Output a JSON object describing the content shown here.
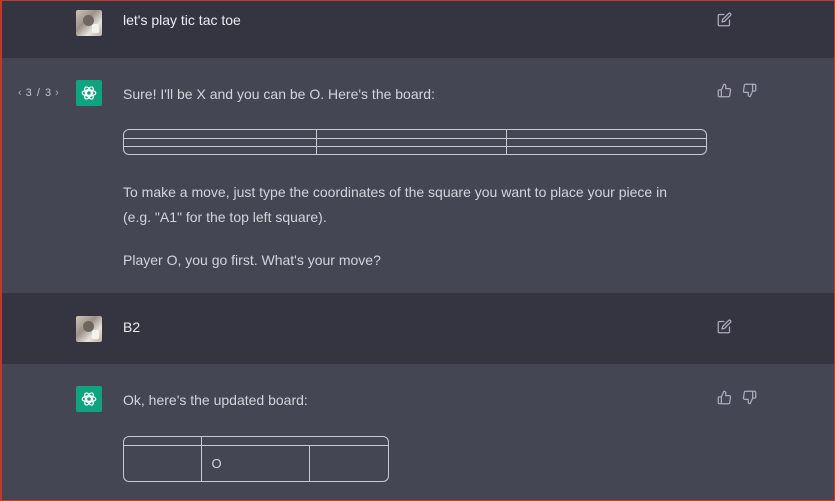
{
  "conversation": {
    "messages": [
      {
        "role": "user",
        "text": "let's play tic tac toe"
      },
      {
        "role": "assistant",
        "pager": {
          "prev": "‹",
          "label": "3 / 3",
          "next": "›"
        },
        "intro": "Sure! I'll be X and you can be O. Here's the board:",
        "board_rows": [
          [
            "",
            "",
            ""
          ],
          [
            "",
            "",
            ""
          ],
          [
            "",
            "",
            ""
          ]
        ],
        "para1_line1": "To make a move, just type the coordinates of the square you want to place your piece in",
        "para1_line2": "(e.g. \"A1\" for the top left square).",
        "para2": "Player O, you go first. What's your move?"
      },
      {
        "role": "user",
        "text": "B2"
      },
      {
        "role": "assistant",
        "intro": "Ok, here's the updated board:",
        "board_rows": [
          [
            "",
            ""
          ],
          [
            "",
            "O",
            ""
          ]
        ]
      }
    ]
  },
  "icons": {
    "edit": "edit-icon",
    "thumbs_up": "thumbs-up-icon",
    "thumbs_down": "thumbs-down-icon",
    "bot_logo": "openai-logo-icon"
  },
  "colors": {
    "user_row_bg": "#343541",
    "assistant_row_bg": "#444654",
    "bot_avatar_bg": "#10a37f"
  }
}
